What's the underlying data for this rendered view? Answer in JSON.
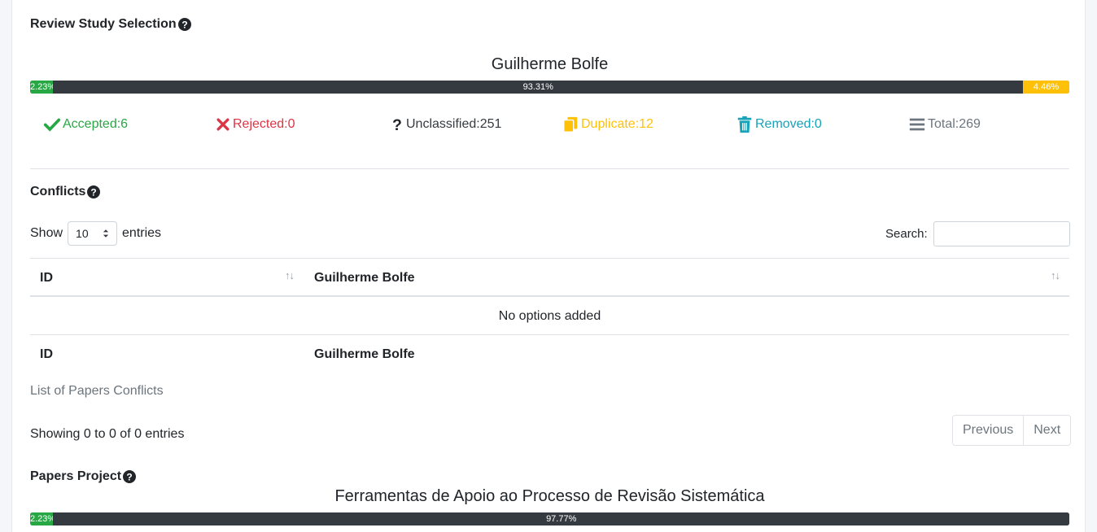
{
  "review": {
    "title": "Review Study Selection",
    "reviewer": "Guilherme Bolfe",
    "progress": {
      "accepted_pct": 2.23,
      "accepted_label": "2.23%",
      "unclassified_pct": 93.31,
      "unclassified_label": "93.31%",
      "duplicate_pct": 4.46,
      "duplicate_label": "4.46%"
    },
    "stats": [
      {
        "label": "Accepted:6",
        "icon": "check-icon",
        "color": "#28a745"
      },
      {
        "label": "Rejected:0",
        "icon": "x-icon",
        "color": "#dc3545"
      },
      {
        "label": "Unclassified:251",
        "icon": "question-icon",
        "color": "#343a40"
      },
      {
        "label": "Duplicate:12",
        "icon": "copy-icon",
        "color": "#ffc107"
      },
      {
        "label": "Removed:0",
        "icon": "trash-icon",
        "color": "#17a2b8"
      },
      {
        "label": "Total:269",
        "icon": "list-icon",
        "color": "#6c757d"
      }
    ]
  },
  "conflicts": {
    "title": "Conflicts",
    "show_label": "Show",
    "entries_value": "10",
    "entries_label": "entries",
    "search_label": "Search:",
    "search_value": "",
    "columns": [
      "ID",
      "Guilherme Bolfe"
    ],
    "empty_message": "No options added",
    "footer_columns": [
      "ID",
      "Guilherme Bolfe"
    ],
    "caption": "List of Papers Conflicts",
    "info": "Showing 0 to 0 of 0 entries",
    "prev_label": "Previous",
    "next_label": "Next"
  },
  "papers": {
    "title": "Papers Project",
    "project_name": "Ferramentas de Apoio ao Processo de Revisão Sistemática",
    "progress": {
      "accepted_pct": 2.23,
      "accepted_label": "2.23%",
      "rest_pct": 97.77,
      "rest_label": "97.77%"
    }
  },
  "colors": {
    "accent_green": "#28a745",
    "bar_dark": "#343a40",
    "warning": "#ffc107",
    "info": "#17a2b8",
    "danger": "#dc3545",
    "muted": "#6c757d"
  }
}
